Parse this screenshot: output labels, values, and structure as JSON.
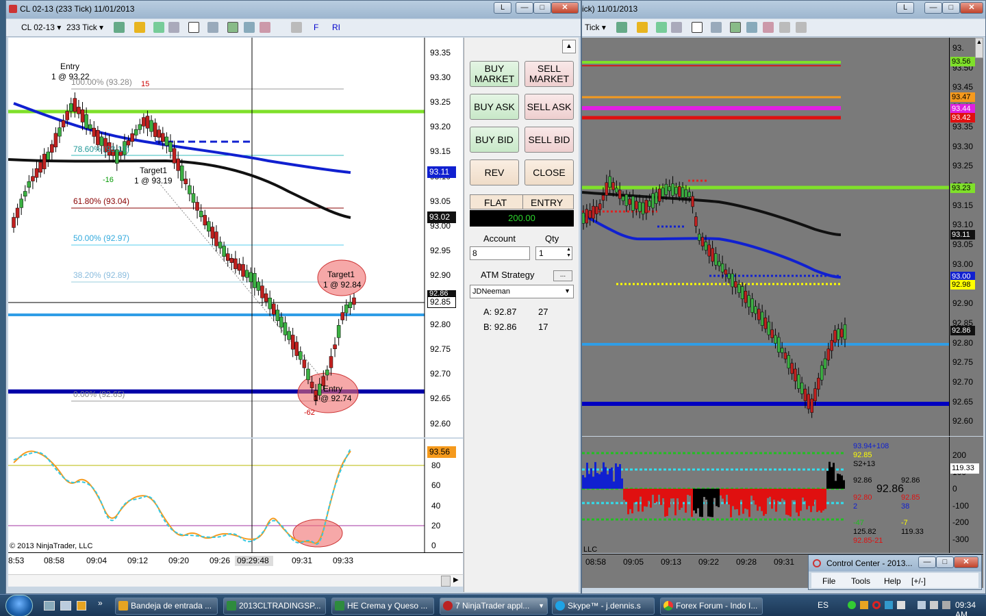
{
  "left_window": {
    "title": "CL 02-13 (233 Tick)  11/01/2013",
    "btn_l": "L",
    "toolbar": {
      "instrument": "CL 02-13",
      "period": "233 Tick",
      "f_label": "F",
      "ri_label": "RI"
    },
    "price_ticks": [
      "93.35",
      "93.30",
      "93.25",
      "93.20",
      "93.15",
      "93.10",
      "93.05",
      "93.00",
      "92.95",
      "92.90",
      "92.85",
      "92.80",
      "92.75",
      "92.70",
      "92.65",
      "92.60"
    ],
    "price_marker_blue": "93.11",
    "price_marker_black": "93.02",
    "price_marker_last": "92.85",
    "price_marker_hidden": "92.86",
    "annotations": {
      "entry_top": "Entry",
      "entry_top_qty": "1 @ 93.22",
      "fib_100": "100.00% (93.28)",
      "fib_786": "78.60% (93.13)",
      "fib_618": "61.80% (93.04)",
      "fib_50": "50.00% (92.97)",
      "fib_382": "38.20% (92.89)",
      "fib_0": "0.00% (92.65)",
      "target1_top": "Target1",
      "target1_top_qty": "1 @ 93.19",
      "target1_bottom": "Target1",
      "target1_bottom_qty": "1 @ 92.84",
      "entry_bottom": "Entry",
      "entry_bottom_qty": "1 @ 92.74",
      "tick_15": "15",
      "tick_m16": "-16",
      "tick_m62": "-62"
    },
    "osc_ticks": [
      "80",
      "60",
      "40",
      "20",
      "0"
    ],
    "osc_marker": "93.56",
    "copyright": "© 2013 NinjaTrader, LLC",
    "time_ticks": [
      "8:53",
      "08:58",
      "09:04",
      "09:12",
      "09:20",
      "09:26",
      "09:31",
      "09:33"
    ],
    "crosshair_time": "09:29:48"
  },
  "order_panel": {
    "buy_market": "BUY MARKET",
    "sell_market": "SELL MARKET",
    "buy_ask": "BUY ASK",
    "sell_ask": "SELL ASK",
    "buy_bid": "BUY BID",
    "sell_bid": "SELL BID",
    "rev": "REV",
    "close": "CLOSE",
    "position": "FLAT",
    "entry_label": "ENTRY",
    "pnl": "200.00",
    "account_label": "Account",
    "account_value": "8",
    "qty_label": "Qty",
    "qty_value": "1",
    "atm_label": "ATM Strategy",
    "atm_value": "JDNeeman",
    "ask_label": "A: 92.87",
    "ask_size": "27",
    "bid_label": "B: 92.86",
    "bid_size": "17"
  },
  "right_window": {
    "title": "ick)  11/01/2013",
    "btn_l": "L",
    "toolbar_period": "Tick",
    "price_ticks": [
      "93.",
      "93.50",
      "93.45",
      "93.40",
      "93.35",
      "93.30",
      "93.25",
      "93.20",
      "93.15",
      "93.10",
      "93.05",
      "93.00",
      "92.95",
      "92.90",
      "92.85",
      "92.80",
      "92.75",
      "92.70",
      "92.65",
      "92.60"
    ],
    "markers": {
      "m1": "93.56",
      "m2": "93.47",
      "m3": "93.44",
      "m4": "93.42",
      "m5": "93.23",
      "m6": "93.11",
      "m7": "93.00",
      "m8": "92.98",
      "m9": "92.86"
    },
    "osc_ticks": [
      "200",
      "100",
      "0",
      "-100",
      "-200",
      "-300"
    ],
    "osc_marker": "119.33",
    "stats": {
      "s1": "93.94+108",
      "s2": "92.85",
      "s3": "S2+13",
      "s4": "92.86",
      "s5": "92.86",
      "s6": "92.86",
      "s7": "92.80",
      "s8": "92.85",
      "s9": "2",
      "s10": "38",
      "s11": "-47",
      "s12": "-7",
      "s13": "125.82",
      "s14": "119.33",
      "s15": "92.85-21"
    },
    "time_ticks": [
      "08:58",
      "09:05",
      "09:13",
      "09:22",
      "09:28",
      "09:31"
    ],
    "llc": "LLC"
  },
  "control_center": {
    "title": "Control Center - 2013...",
    "menu": [
      "File",
      "Tools",
      "Help",
      "[+/-]"
    ]
  },
  "taskbar": {
    "tasks": [
      "Bandeja de entrada ...",
      "2013CLTRADINGSP...",
      "HE Crema y Queso ...",
      "7 NinjaTrader appl...",
      "Skype™ - j.dennis.s",
      "Forex Forum - Indo I..."
    ],
    "lang": "ES",
    "clock": "09:34 AM"
  },
  "colors": {
    "green_line": "#7fe02a",
    "blue_line": "#2f9de6",
    "navy_line": "#0000a8",
    "ma_blue": "#1020d0",
    "ma_black": "#111111",
    "bull": "#3cb043",
    "bear": "#c0201f",
    "osc_orange": "#f59a1d",
    "osc_cyan": "#36c8e0",
    "pnl_green": "#2dd52d"
  }
}
